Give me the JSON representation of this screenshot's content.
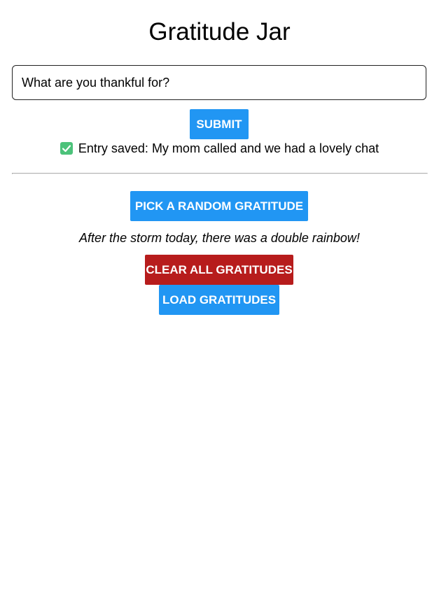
{
  "app": {
    "title": "Gratitude Jar"
  },
  "entry": {
    "placeholder": "What are you thankful for?",
    "value": "",
    "submit_label": "SUBMIT",
    "status_icon": "check-icon",
    "status_text": "Entry saved: My mom called and we had a lovely chat"
  },
  "random": {
    "button_label": "PICK A RANDOM GRATITUDE",
    "result_text": "After the storm today, there was a double rainbow!"
  },
  "actions": {
    "clear_label": "CLEAR ALL GRATITUDES",
    "load_label": "LOAD GRATITUDES"
  },
  "colors": {
    "primary_button": "#2196f3",
    "danger_button": "#b71c1c",
    "success_check": "#4cc27a",
    "divider": "#b3b3b3"
  }
}
